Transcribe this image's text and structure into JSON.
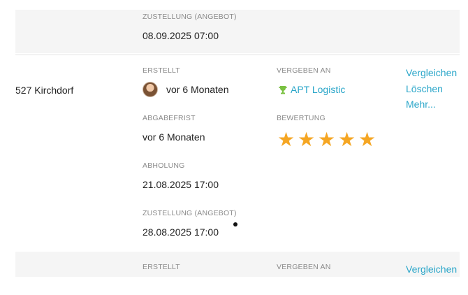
{
  "top_row": {
    "delivery_label": "ZUSTELLUNG (ANGEBOT)",
    "delivery_value": "08.09.2025 07:00"
  },
  "main_row": {
    "address": "527 Kirchdorf",
    "created_label": "ERSTELLT",
    "created_value": "vor 6 Monaten",
    "deadline_label": "ABGABEFRIST",
    "deadline_value": "vor 6 Monaten",
    "pickup_label": "ABHOLUNG",
    "pickup_value": "21.08.2025 17:00",
    "delivery_label": "ZUSTELLUNG (ANGEBOT)",
    "delivery_value": "28.08.2025 17:00",
    "awarded_label": "VERGEBEN AN",
    "awarded_value": "APT Logistic",
    "rating_label": "BEWERTUNG",
    "rating": 5,
    "rating_max": 5,
    "actions": [
      "Vergleichen",
      "Löschen",
      "Mehr..."
    ]
  },
  "bottom_row": {
    "created_label": "ERSTELLT",
    "awarded_label": "VERGEBEN AN",
    "action": "Vergleichen"
  },
  "colors": {
    "link": "#2aa6c9",
    "star": "#f5a623",
    "trophy": "#7ac142",
    "row_alt_bg": "#f5f5f5"
  },
  "icons": [
    "user-avatar",
    "trophy-icon",
    "star-icon"
  ]
}
